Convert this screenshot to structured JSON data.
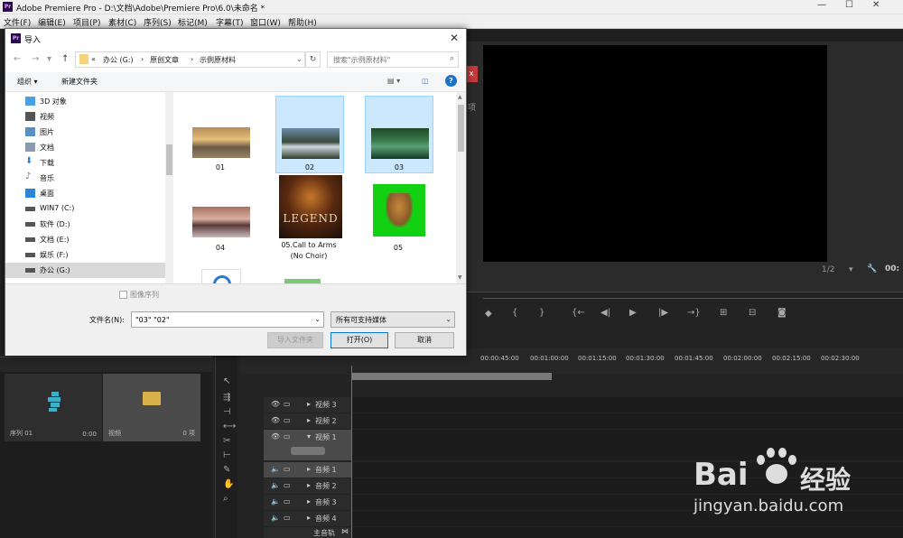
{
  "app": {
    "title": "Adobe Premiere Pro - D:\\文档\\Adobe\\Premiere Pro\\6.0\\未命名 *",
    "logo": "Pr",
    "menu": [
      "文件(F)",
      "编辑(E)",
      "项目(P)",
      "素材(C)",
      "序列(S)",
      "标记(M)",
      "字幕(T)",
      "窗口(W)",
      "帮助(H)"
    ]
  },
  "monitor": {
    "tab_fragment": "项",
    "zoom": "1/2",
    "time": "00:"
  },
  "project": {
    "items": [
      {
        "label": "序列 01",
        "count": "0:00"
      },
      {
        "label": "视频",
        "count": "0 项"
      }
    ]
  },
  "timeline": {
    "ruler": [
      "00:00:45:00",
      "00:01:00:00",
      "00:01:15:00",
      "00:01:30:00",
      "00:01:45:00",
      "00:02:00:00",
      "00:02:15:00",
      "00:02:30:00"
    ],
    "video_tracks": [
      "视频 3",
      "视频 2",
      "视频 1"
    ],
    "audio_tracks": [
      "音频 1",
      "音频 2",
      "音频 3",
      "音频 4"
    ],
    "master": "主音轨"
  },
  "dialog": {
    "title": "导入",
    "path": [
      "«",
      "办公 (G:)",
      "原创文章",
      "示例原材料"
    ],
    "search_placeholder": "搜索\"示例原材料\"",
    "organize": "组织 ▾",
    "new_folder": "新建文件夹",
    "nav_items": [
      "3D 对象",
      "视频",
      "图片",
      "文档",
      "下载",
      "音乐",
      "桌面",
      "WIN7 (C:)",
      "软件 (D:)",
      "文档 (E:)",
      "娱乐 (F:)",
      "办公 (G:)"
    ],
    "files": [
      {
        "name": "01"
      },
      {
        "name": "02"
      },
      {
        "name": "03"
      },
      {
        "name": "04"
      },
      {
        "name": "05.Call to Arms\n(No Choir)",
        "overlay": "LEGEND"
      },
      {
        "name": "05"
      }
    ],
    "image_sequence": "图像序列",
    "filename_label": "文件名(N):",
    "filename_value": "\"03\" \"02\"",
    "filetype": "所有可支持媒体",
    "import_folder": "导入文件夹",
    "open": "打开(O)",
    "cancel": "取消"
  },
  "watermark": {
    "brand": "Bai",
    "brand2": "经验",
    "url": "jingyan.baidu.com"
  }
}
